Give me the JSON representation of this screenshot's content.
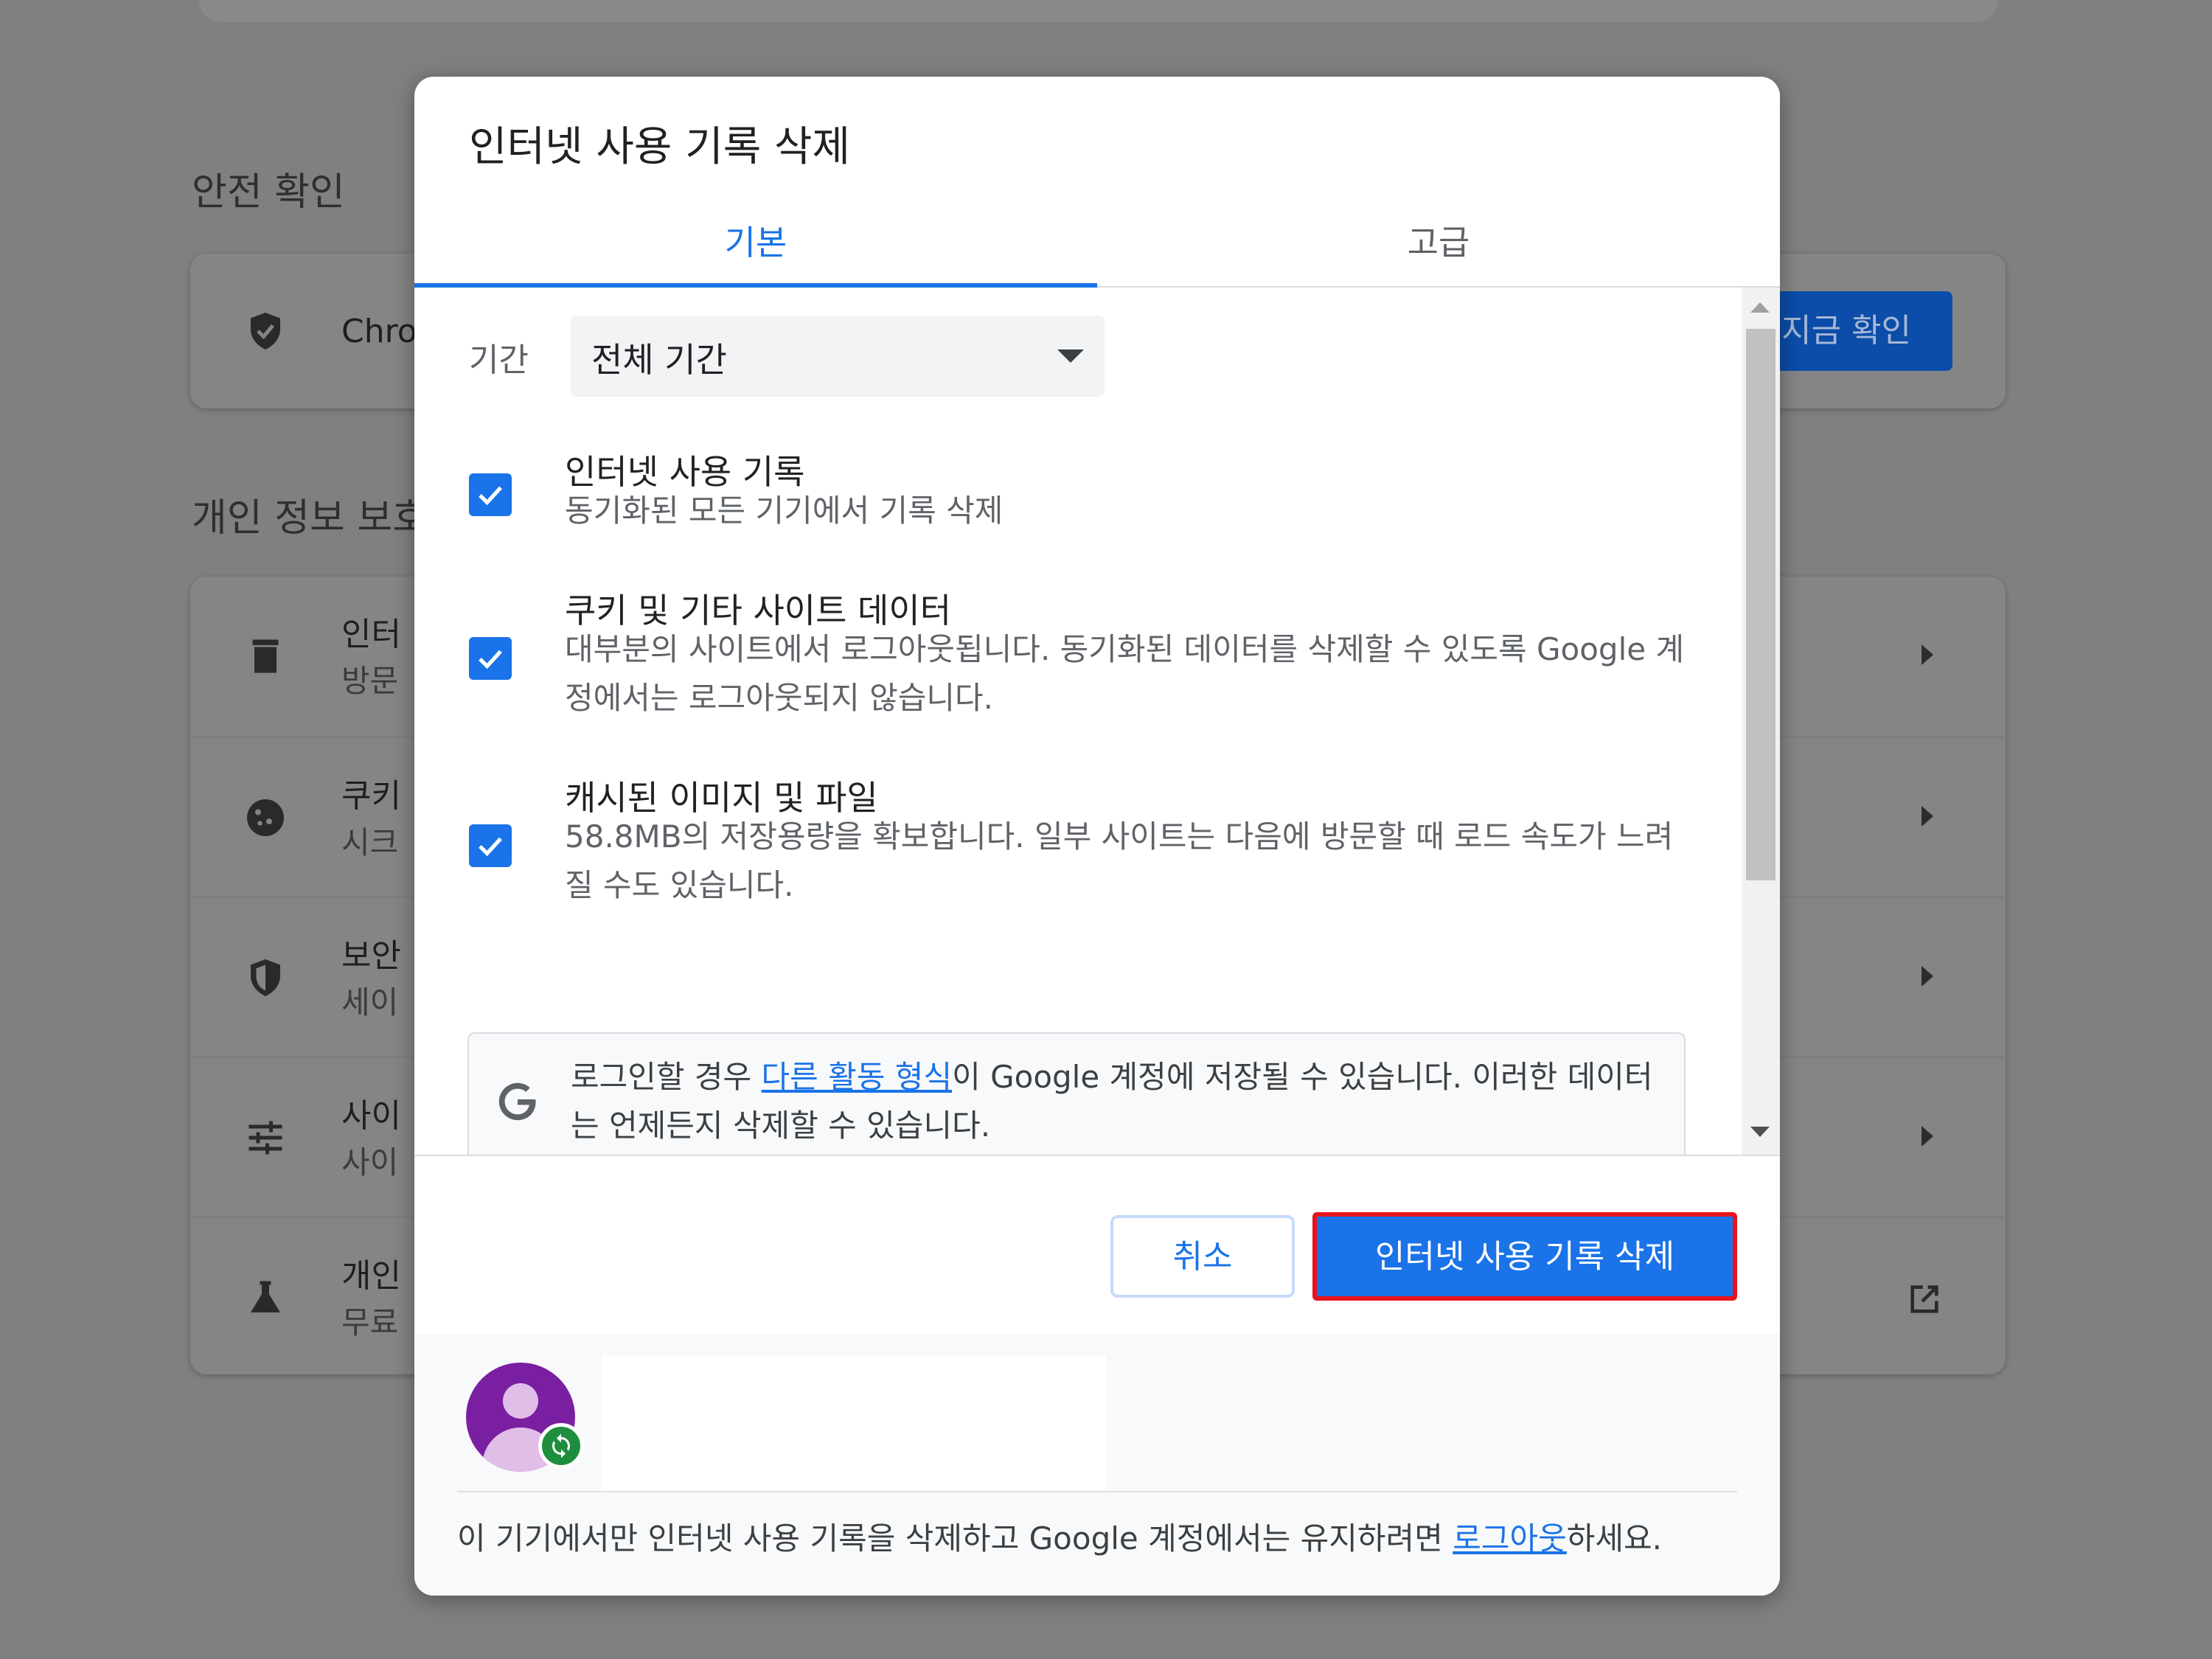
{
  "background": {
    "safety_check_title": "안전 확인",
    "safety_row_label": "Chro",
    "check_now_button": "지금 확인",
    "privacy_title": "개인 정보 보호",
    "rows": [
      {
        "title": "인터",
        "subtitle": "방문"
      },
      {
        "title": "쿠키",
        "subtitle": "시크"
      },
      {
        "title": "보안",
        "subtitle": "세이"
      },
      {
        "title": "사이",
        "subtitle": "사이"
      },
      {
        "title": "개인",
        "subtitle": "무료"
      }
    ]
  },
  "dialog": {
    "title": "인터넷 사용 기록 삭제",
    "tabs": [
      {
        "label": "기본",
        "active": true
      },
      {
        "label": "고급",
        "active": false
      }
    ],
    "period": {
      "label": "기간",
      "value": "전체 기간"
    },
    "options": [
      {
        "title": "인터넷 사용 기록",
        "description": "동기화된 모든 기기에서 기록 삭제",
        "checked": true
      },
      {
        "title": "쿠키 및 기타 사이트 데이터",
        "description": "대부분의 사이트에서 로그아웃됩니다. 동기화된 데이터를 삭제할 수 있도록 Google 계정에서는 로그아웃되지 않습니다.",
        "checked": true
      },
      {
        "title": "캐시된 이미지 및 파일",
        "description": "58.8MB의 저장용량을 확보합니다. 일부 사이트는 다음에 방문할 때 로드 속도가 느려질 수도 있습니다.",
        "checked": true
      }
    ],
    "google_notice": {
      "before": "로그인할 경우 ",
      "link": "다른 활동 형식",
      "after": "이 Google 계정에 저장될 수 있습니다. 이러한 데이터는 언제든지 삭제할 수 있습니다."
    },
    "buttons": {
      "cancel": "취소",
      "clear": "인터넷 사용 기록 삭제"
    },
    "signout_notice": {
      "before": "이 기기에서만 인터넷 사용 기록을 삭제하고 Google 계정에서는 유지하려면 ",
      "link": "로그아웃",
      "after": "하세요."
    }
  },
  "colors": {
    "accent": "#1a73e8",
    "highlight_border": "#e8141c",
    "avatar": "#7b1fa2",
    "sync_badge": "#1e8e3e"
  }
}
